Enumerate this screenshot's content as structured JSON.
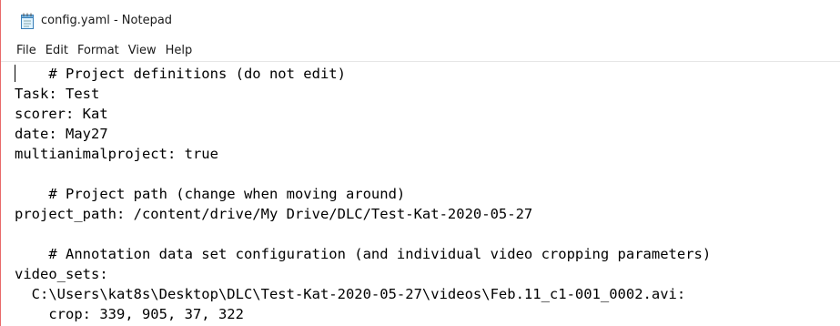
{
  "window": {
    "title": "config.yaml - Notepad",
    "icon": "notepad-icon"
  },
  "menu": [
    {
      "label": "File"
    },
    {
      "label": "Edit"
    },
    {
      "label": "Format"
    },
    {
      "label": "View"
    },
    {
      "label": "Help"
    }
  ],
  "editor": {
    "lines": [
      "    # Project definitions (do not edit)",
      "Task: Test",
      "scorer: Kat",
      "date: May27",
      "multianimalproject: true",
      "",
      "    # Project path (change when moving around)",
      "project_path: /content/drive/My Drive/DLC/Test-Kat-2020-05-27",
      "",
      "    # Annotation data set configuration (and individual video cropping parameters)",
      "video_sets:",
      "  C:\\Users\\kat8s\\Desktop\\DLC\\Test-Kat-2020-05-27\\videos\\Feb.11_c1-001_0002.avi:",
      "    crop: 339, 905, 37, 322"
    ]
  }
}
